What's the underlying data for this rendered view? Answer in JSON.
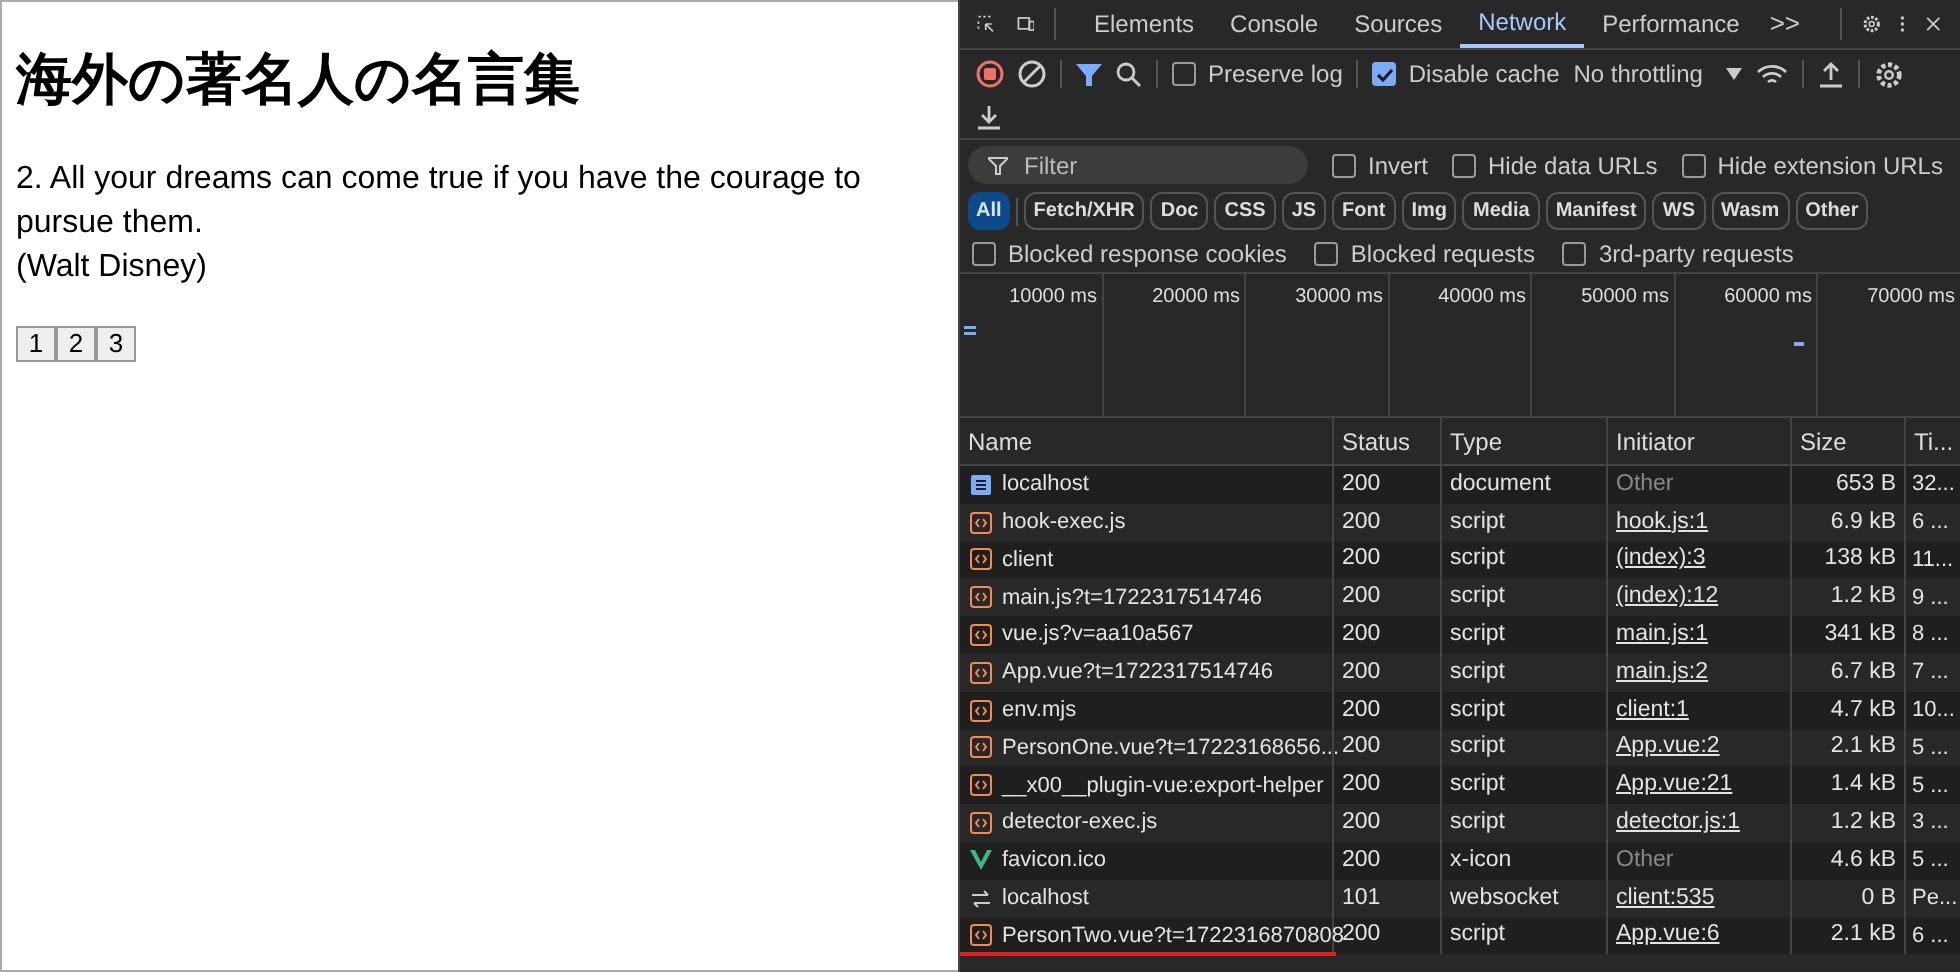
{
  "page": {
    "heading": "海外の著名人の名言集",
    "quote": "2. All your dreams can come true if you have the courage to pursue them.",
    "author": "(Walt Disney)",
    "pages": [
      {
        "label": "1"
      },
      {
        "label": "2"
      },
      {
        "label": "3"
      }
    ]
  },
  "devtools": {
    "tabs": [
      {
        "label": "Elements",
        "selected": false
      },
      {
        "label": "Console",
        "selected": false
      },
      {
        "label": "Sources",
        "selected": false
      },
      {
        "label": "Network",
        "selected": true
      },
      {
        "label": "Performance",
        "selected": false
      }
    ],
    "more_tabs": ">>",
    "toolbar": {
      "preserve_log": {
        "label": "Preserve log",
        "checked": false
      },
      "disable_cache": {
        "label": "Disable cache",
        "checked": true
      },
      "throttling": "No throttling"
    },
    "filter": {
      "placeholder": "Filter",
      "options": [
        {
          "label": "Invert",
          "checked": false
        },
        {
          "label": "Hide data URLs",
          "checked": false
        },
        {
          "label": "Hide extension URLs",
          "checked": false
        }
      ]
    },
    "types": [
      {
        "label": "All",
        "selected": true
      },
      {
        "label": "Fetch/XHR",
        "selected": false
      },
      {
        "label": "Doc",
        "selected": false
      },
      {
        "label": "CSS",
        "selected": false
      },
      {
        "label": "JS",
        "selected": false
      },
      {
        "label": "Font",
        "selected": false
      },
      {
        "label": "Img",
        "selected": false
      },
      {
        "label": "Media",
        "selected": false
      },
      {
        "label": "Manifest",
        "selected": false
      },
      {
        "label": "WS",
        "selected": false
      },
      {
        "label": "Wasm",
        "selected": false
      },
      {
        "label": "Other",
        "selected": false
      }
    ],
    "blocked": [
      {
        "label": "Blocked response cookies",
        "checked": false
      },
      {
        "label": "Blocked requests",
        "checked": false
      },
      {
        "label": "3rd-party requests",
        "checked": false
      }
    ],
    "timeline": {
      "ticks": [
        "10000 ms",
        "20000 ms",
        "30000 ms",
        "40000 ms",
        "50000 ms",
        "60000 ms",
        "70000 ms"
      ]
    },
    "table": {
      "columns": [
        "Name",
        "Status",
        "Type",
        "Initiator",
        "Size",
        "Ti..."
      ],
      "rows": [
        {
          "kind": "document",
          "name": "localhost",
          "status": "200",
          "type": "document",
          "initiator": "Other",
          "initiator_link": false,
          "size": "653 B",
          "time": "32...",
          "underlined": false
        },
        {
          "kind": "script",
          "name": "hook-exec.js",
          "status": "200",
          "type": "script",
          "initiator": "hook.js:1",
          "initiator_link": true,
          "size": "6.9 kB",
          "time": "6 ...",
          "underlined": false
        },
        {
          "kind": "script",
          "name": "client",
          "status": "200",
          "type": "script",
          "initiator": "(index):3",
          "initiator_link": true,
          "size": "138 kB",
          "time": "11...",
          "underlined": false
        },
        {
          "kind": "script",
          "name": "main.js?t=1722317514746",
          "status": "200",
          "type": "script",
          "initiator": "(index):12",
          "initiator_link": true,
          "size": "1.2 kB",
          "time": "9 ...",
          "underlined": false
        },
        {
          "kind": "script",
          "name": "vue.js?v=aa10a567",
          "status": "200",
          "type": "script",
          "initiator": "main.js:1",
          "initiator_link": true,
          "size": "341 kB",
          "time": "8 ...",
          "underlined": false
        },
        {
          "kind": "script",
          "name": "App.vue?t=1722317514746",
          "status": "200",
          "type": "script",
          "initiator": "main.js:2",
          "initiator_link": true,
          "size": "6.7 kB",
          "time": "7 ...",
          "underlined": false
        },
        {
          "kind": "script",
          "name": "env.mjs",
          "status": "200",
          "type": "script",
          "initiator": "client:1",
          "initiator_link": true,
          "size": "4.7 kB",
          "time": "10...",
          "underlined": false
        },
        {
          "kind": "script",
          "name": "PersonOne.vue?t=17223168656...",
          "status": "200",
          "type": "script",
          "initiator": "App.vue:2",
          "initiator_link": true,
          "size": "2.1 kB",
          "time": "5 ...",
          "underlined": false
        },
        {
          "kind": "script",
          "name": "__x00__plugin-vue:export-helper",
          "status": "200",
          "type": "script",
          "initiator": "App.vue:21",
          "initiator_link": true,
          "size": "1.4 kB",
          "time": "5 ...",
          "underlined": false
        },
        {
          "kind": "script",
          "name": "detector-exec.js",
          "status": "200",
          "type": "script",
          "initiator": "detector.js:1",
          "initiator_link": true,
          "size": "1.2 kB",
          "time": "3 ...",
          "underlined": false
        },
        {
          "kind": "icon",
          "name": "favicon.ico",
          "status": "200",
          "type": "x-icon",
          "initiator": "Other",
          "initiator_link": false,
          "size": "4.6 kB",
          "time": "5 ...",
          "underlined": false
        },
        {
          "kind": "websocket",
          "name": "localhost",
          "status": "101",
          "type": "websocket",
          "initiator": "client:535",
          "initiator_link": true,
          "size": "0 B",
          "time": "Pe...",
          "underlined": false
        },
        {
          "kind": "script",
          "name": "PersonTwo.vue?t=1722316870808",
          "status": "200",
          "type": "script",
          "initiator": "App.vue:6",
          "initiator_link": true,
          "size": "2.1 kB",
          "time": "6 ...",
          "underlined": true
        }
      ]
    }
  }
}
